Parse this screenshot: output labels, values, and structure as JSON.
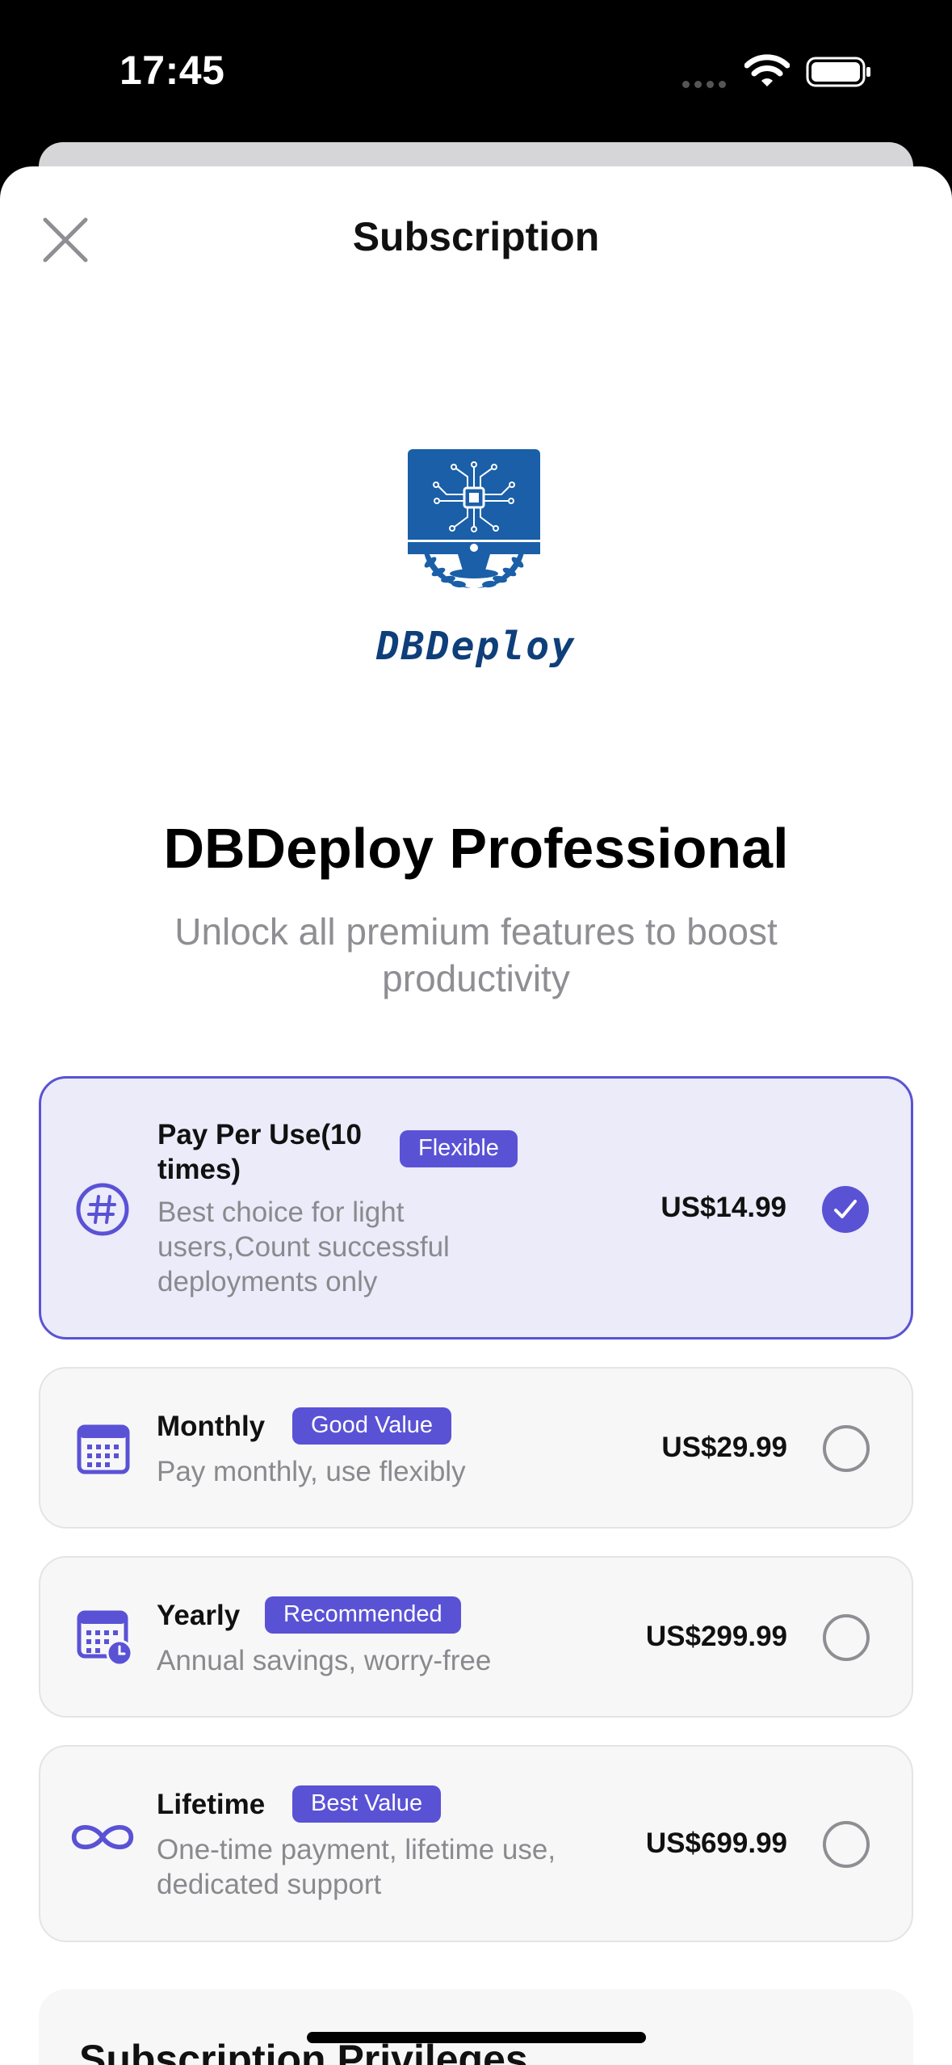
{
  "status_bar": {
    "time": "17:45",
    "icons": [
      "signal-dots-icon",
      "wifi-icon",
      "battery-icon"
    ]
  },
  "header": {
    "title": "Subscription",
    "close_icon": "close-icon"
  },
  "brand": {
    "logo_icon": "monitor-chip-laurel-logo",
    "logo_text": "DBDeploy"
  },
  "hero": {
    "title": "DBDeploy Professional",
    "subtitle": "Unlock all premium features to boost productivity"
  },
  "plans": [
    {
      "name": "Pay Per Use(10 times)",
      "badge": "Flexible",
      "description": "Best choice for light users,Count successful deployments only",
      "price": "US$14.99",
      "icon": "hash-circle-icon",
      "selected": true
    },
    {
      "name": "Monthly",
      "badge": "Good Value",
      "description": "Pay monthly, use flexibly",
      "price": "US$29.99",
      "icon": "calendar-icon",
      "selected": false
    },
    {
      "name": "Yearly",
      "badge": "Recommended",
      "description": "Annual savings, worry-free",
      "price": "US$299.99",
      "icon": "calendar-clock-icon",
      "selected": false
    },
    {
      "name": "Lifetime",
      "badge": "Best Value",
      "description": "One-time payment, lifetime use, dedicated support",
      "price": "US$699.99",
      "icon": "infinity-icon",
      "selected": false
    }
  ],
  "privileges": {
    "title": "Subscription Privileges"
  },
  "colors": {
    "accent": "#5a52d5",
    "selected_background": "#ebebfa",
    "card_background": "#f7f7f8",
    "secondary_text": "#8e8e93",
    "logo_blue": "#1a5fa8"
  }
}
